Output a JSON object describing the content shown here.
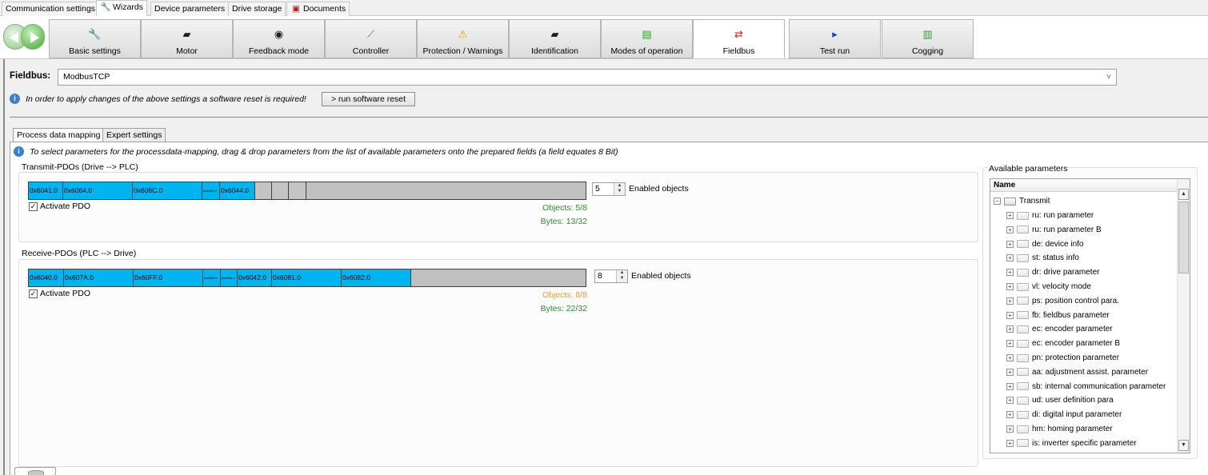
{
  "top_tabs": [
    {
      "label": "Communication settings",
      "active": false,
      "icon": ""
    },
    {
      "label": "Wizards",
      "active": true,
      "icon": "wrench-icon"
    },
    {
      "label": "Device parameters",
      "active": false,
      "icon": ""
    },
    {
      "label": "Drive storage",
      "active": false,
      "icon": ""
    },
    {
      "label": "Documents",
      "active": false,
      "icon": "pdf-icon"
    }
  ],
  "wizard_tabs": [
    {
      "label": "Basic settings",
      "icon": "wrench-icon",
      "glyph": "🔧",
      "active": false
    },
    {
      "label": "Motor",
      "icon": "motor-icon",
      "glyph": "▰",
      "active": false
    },
    {
      "label": "Feedback mode",
      "icon": "encoder-icon",
      "glyph": "◉",
      "active": false
    },
    {
      "label": "Controller",
      "icon": "controller-graph-icon",
      "glyph": "⟋",
      "active": false
    },
    {
      "label": "Protection / Warnings",
      "icon": "warning-icon",
      "glyph": "⚠",
      "active": false
    },
    {
      "label": "Identification",
      "icon": "motor-icon",
      "glyph": "▰",
      "active": false
    },
    {
      "label": "Modes of operation",
      "icon": "modes-icon",
      "glyph": "▤",
      "active": false
    },
    {
      "label": "Fieldbus",
      "icon": "fieldbus-arrows-icon",
      "glyph": "⇄",
      "active": true
    },
    {
      "label": "Test run",
      "icon": "play-icon",
      "glyph": "▸",
      "active": false
    },
    {
      "label": "Cogging",
      "icon": "cogging-chart-icon",
      "glyph": "▥",
      "active": false
    }
  ],
  "fieldbus": {
    "label": "Fieldbus:",
    "value": "ModbusTCP",
    "info": "In order to apply changes of the above settings a software reset is required!",
    "reset_button": "> run software reset"
  },
  "inner_tabs": [
    {
      "label": "Process data mapping",
      "active": true
    },
    {
      "label": "Expert settings",
      "active": false
    }
  ],
  "mapping_info": "To select parameters for the processdata-mapping, drag & drop parameters from the list of available parameters onto the prepared fields (a field equates 8 Bit)",
  "transmit": {
    "title": "Transmit-PDOs (Drive --> PLC)",
    "slots": [
      "0x6041.0",
      "0x6064.0",
      "0x606C.0",
      "0x6061.0",
      "0x6044.0"
    ],
    "enabled_count": "5",
    "enabled_label": "Enabled objects",
    "activate_label": "Activate PDO",
    "objects": "Objects: 5/8",
    "bytes": "Bytes: 13/32",
    "objects_color": "#2e8b2e",
    "bytes_color": "#2e8b2e"
  },
  "receive": {
    "title": "Receive-PDOs (PLC --> Drive)",
    "slots": [
      "0x6040.0",
      "0x607A.0",
      "0x60FF.0",
      "0x6060.0",
      "0x6060.0",
      "0x6042.0",
      "0x6081.0",
      "0x6082.0"
    ],
    "enabled_count": "8",
    "enabled_label": "Enabled objects",
    "activate_label": "Activate PDO",
    "objects": "Objects: 8/8",
    "bytes": "Bytes: 22/32",
    "objects_color": "#f0a020",
    "bytes_color": "#2e8b2e"
  },
  "available": {
    "title": "Available parameters",
    "column": "Name",
    "root": "Transmit",
    "items": [
      "ru: run parameter",
      "ru: run parameter B",
      "de: device info",
      "st: status info",
      "dr: drive parameter",
      "vl: velocity mode",
      "ps: position control para.",
      "fb: fieldbus parameter",
      "ec: encoder parameter",
      "ec: encoder parameter B",
      "pn: protection parameter",
      "aa: adjustment assist. parameter",
      "sb: internal communication parameter",
      "ud: user definition para",
      "di: digital input parameter",
      "hm: homing parameter",
      "is: inverter specific parameter"
    ]
  },
  "colors": {
    "pdo_fill": "#00b4f0",
    "pdo_empty": "#c0c0c0",
    "status_ok": "#2e8b2e",
    "status_warn": "#f0a020"
  }
}
